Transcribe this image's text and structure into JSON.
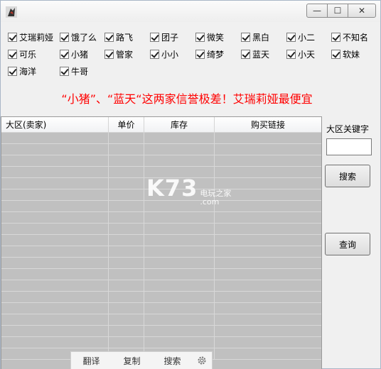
{
  "window": {
    "minimize_glyph": "—",
    "maximize_glyph": "☐",
    "close_glyph": "✕"
  },
  "checkboxes": [
    {
      "label": "艾瑞莉娅",
      "checked": true
    },
    {
      "label": "饿了么",
      "checked": true
    },
    {
      "label": "路飞",
      "checked": true
    },
    {
      "label": "团子",
      "checked": true
    },
    {
      "label": "微笑",
      "checked": true
    },
    {
      "label": "黑白",
      "checked": true
    },
    {
      "label": "小二",
      "checked": true
    },
    {
      "label": "不知名",
      "checked": true
    },
    {
      "label": "可乐",
      "checked": true
    },
    {
      "label": "小猪",
      "checked": true
    },
    {
      "label": "管家",
      "checked": true
    },
    {
      "label": "小小",
      "checked": true
    },
    {
      "label": "绮梦",
      "checked": true
    },
    {
      "label": "蓝天",
      "checked": true
    },
    {
      "label": "小天",
      "checked": true
    },
    {
      "label": "软妹",
      "checked": true
    },
    {
      "label": "海洋",
      "checked": true
    },
    {
      "label": "牛哥",
      "checked": true
    }
  ],
  "notice": "“小猪”、“蓝天“这两家信誉极差！艾瑞莉娅最便宜",
  "table": {
    "columns": [
      "大区(卖家)",
      "单价",
      "库存",
      "购买链接"
    ],
    "row_count": 20
  },
  "side": {
    "keyword_label": "大区关键字",
    "keyword_value": "",
    "search_button": "搜索",
    "query_button": "查询"
  },
  "watermark": {
    "main": "K73",
    "sub_top": "电玩之家",
    "sub_bottom": ".com"
  },
  "toolbar": {
    "translate": "翻译",
    "copy": "复制",
    "search": "搜索"
  },
  "colors": {
    "notice": "#ff0000",
    "table_bg": "#c0c0c0"
  }
}
